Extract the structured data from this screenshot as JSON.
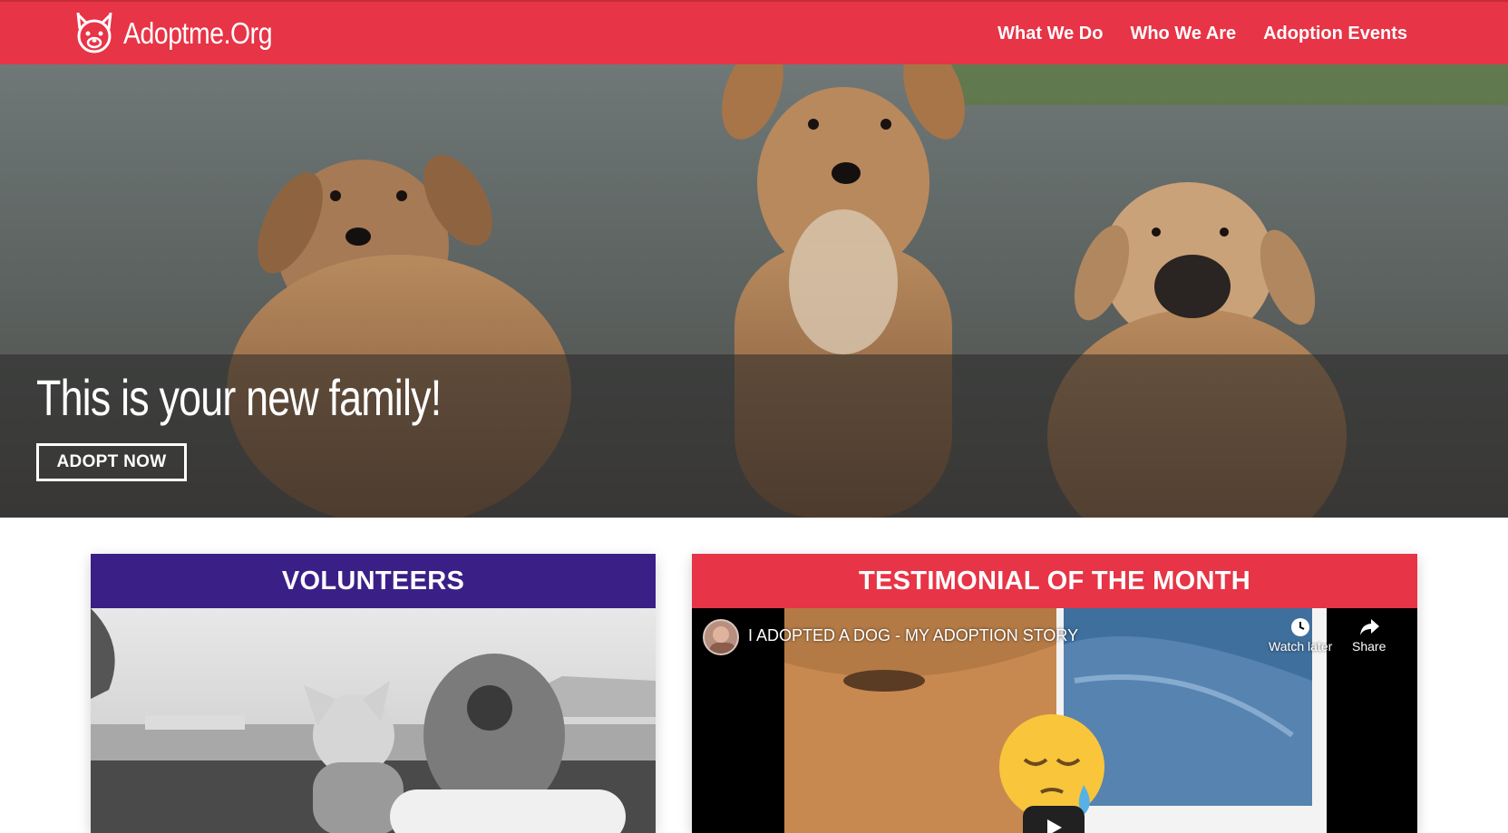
{
  "nav": {
    "brand": "Adoptme.Org",
    "links": [
      "What We Do",
      "Who We Are",
      "Adoption Events"
    ],
    "color": "#e73446"
  },
  "hero": {
    "title": "This is your new family!",
    "button_label": "ADOPT NOW"
  },
  "volunteers": {
    "heading": "VOLUNTEERS",
    "color": "#3a2086"
  },
  "testimonial": {
    "heading": "TESTIMONIAL OF THE MONTH",
    "color": "#e73446",
    "video": {
      "title": "I ADOPTED A DOG - MY ADOPTION STORY",
      "watch_later_label": "Watch later",
      "share_label": "Share"
    }
  },
  "icons": [
    "dog-logo-icon",
    "clock-icon",
    "share-arrow-icon",
    "play-icon",
    "emoji-icon"
  ]
}
